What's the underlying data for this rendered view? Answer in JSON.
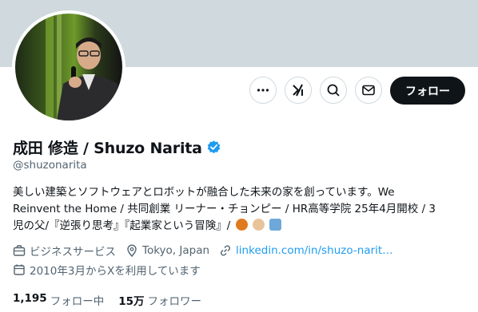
{
  "profile": {
    "name": "成田 修造 / Shuzo Narita",
    "handle": "@shuzonarita",
    "bio_lines": [
      "美しい建築とソフトウェアとロボットが融合した未来の家を創っています。We",
      "Reinvent the Home / 共同創業 リーナー・チョンピー / HR高等学院 25年4月開校 / 3",
      "児の父/『逆張り思考』『起業家という冒険』/"
    ],
    "category": "ビジネスサービス",
    "location": "Tokyo, Japan",
    "website": "linkedin.com/in/shuzo-narit…",
    "joined": "2010年3月からXを利用しています",
    "following_count": "1,195",
    "following_label": "フォロー中",
    "followers_count": "15万",
    "followers_label": "フォロワー"
  },
  "actions": {
    "follow_label": "フォロー",
    "more_icon": "more-icon",
    "grok_icon": "grok-icon",
    "search_icon": "search-icon",
    "message_icon": "message-icon"
  },
  "colors": {
    "banner": "#cfd9de",
    "accent": "#1d9bf0",
    "text": "#0f1419",
    "muted": "#536471",
    "follow_bg": "#0f1419"
  }
}
